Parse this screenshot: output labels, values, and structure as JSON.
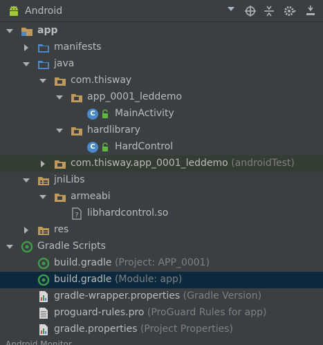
{
  "toolbar": {
    "view_selector_label": "Android",
    "icons": [
      "android-icon",
      "dropdown-caret-icon",
      "target-icon",
      "collapse-all-icon",
      "gear-icon",
      "hide-panel-icon"
    ]
  },
  "tree": [
    {
      "label": "app",
      "kind": "module",
      "bold": true,
      "expanded": true
    },
    {
      "label": "manifests",
      "kind": "folder",
      "expanded": false
    },
    {
      "label": "java",
      "kind": "folder",
      "expanded": true
    },
    {
      "label": "com.thisway",
      "kind": "package",
      "expanded": true
    },
    {
      "label": "app_0001_leddemo",
      "kind": "package",
      "expanded": true
    },
    {
      "label": "MainActivity",
      "kind": "class"
    },
    {
      "label": "hardlibrary",
      "kind": "package",
      "expanded": true
    },
    {
      "label": "HardControl",
      "kind": "class"
    },
    {
      "label": "com.thisway.app_0001_leddemo",
      "hint": "(androidTest)",
      "kind": "package",
      "expanded": false
    },
    {
      "label": "jniLibs",
      "kind": "res-folder",
      "expanded": true
    },
    {
      "label": "armeabi",
      "kind": "package",
      "expanded": true
    },
    {
      "label": "libhardcontrol.so",
      "kind": "file-unknown"
    },
    {
      "label": "res",
      "kind": "res-folder",
      "expanded": false
    },
    {
      "label": "Gradle Scripts",
      "kind": "gradle-root",
      "expanded": true
    },
    {
      "label": "build.gradle",
      "hint": "(Project: APP_0001)",
      "kind": "gradle"
    },
    {
      "label": "build.gradle",
      "hint": "(Module: app)",
      "kind": "gradle",
      "selected": true
    },
    {
      "label": "gradle-wrapper.properties",
      "hint": "(Gradle Version)",
      "kind": "properties"
    },
    {
      "label": "proguard-rules.pro",
      "hint": "(ProGuard Rules for app)",
      "kind": "file"
    },
    {
      "label": "gradle.properties",
      "hint": "(Project Properties)",
      "kind": "properties"
    }
  ],
  "bottom_panel": {
    "label": "Android Monitor"
  },
  "colors": {
    "background": "#3c3f41",
    "selection": "#0d293e",
    "folder": "#c09a5b",
    "package": "#c09a5b",
    "class": "#4a88c7",
    "gradle": "#3f9b4a",
    "hint": "#808080",
    "text": "#bbbbbb"
  }
}
